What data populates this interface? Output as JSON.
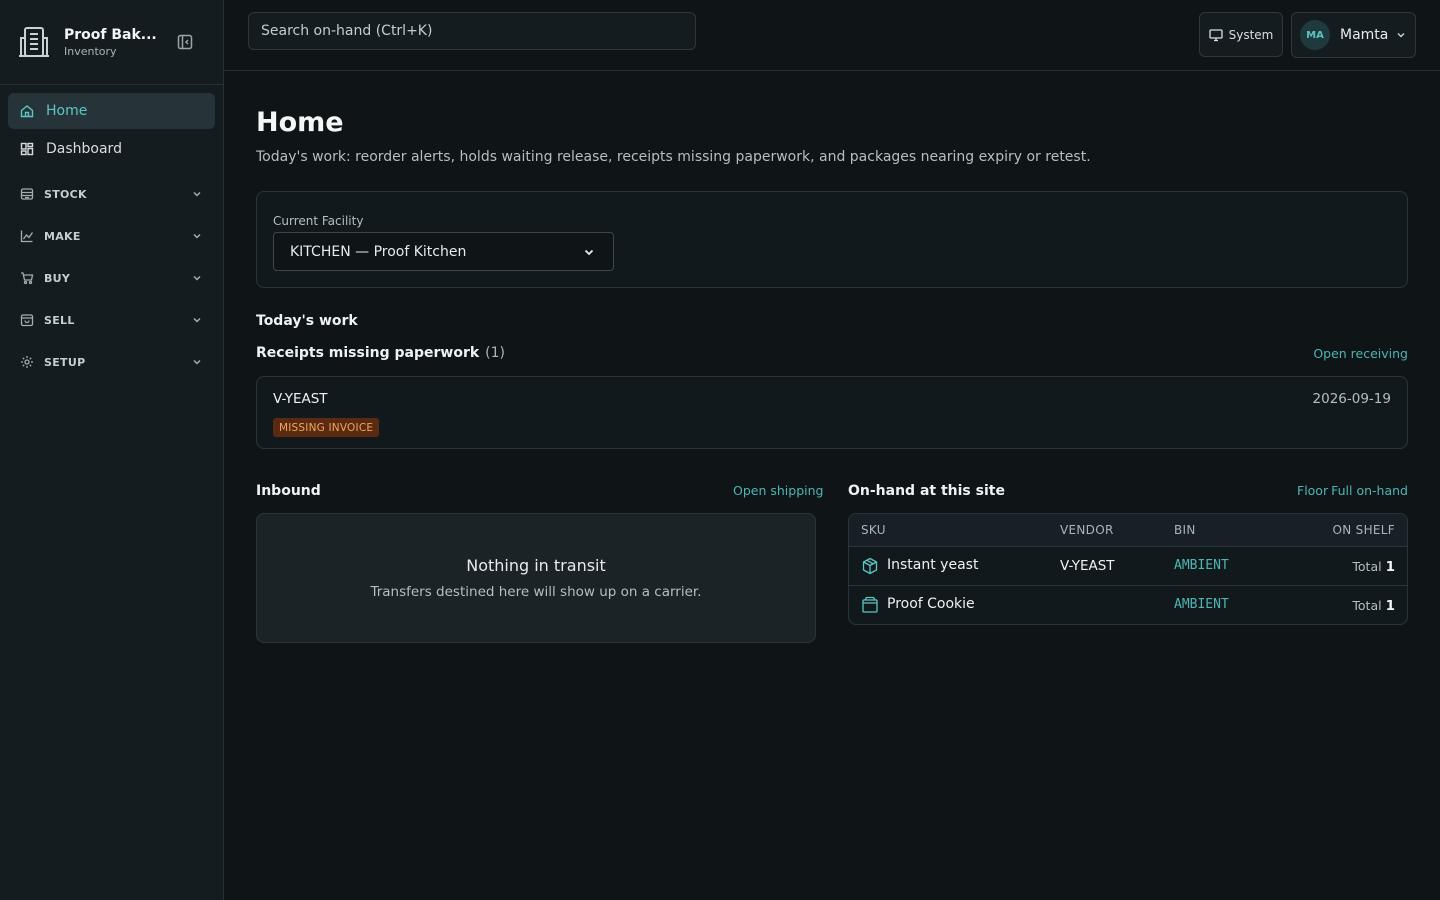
{
  "brand": {
    "name": "Proof Bak...",
    "subtitle": "Inventory"
  },
  "sidebar": {
    "items": [
      {
        "label": "Home",
        "icon": "home-icon",
        "active": true
      },
      {
        "label": "Dashboard",
        "icon": "dashboard-icon",
        "active": false
      }
    ],
    "groups": [
      {
        "label": "STOCK",
        "icon": "stock-icon"
      },
      {
        "label": "MAKE",
        "icon": "make-icon"
      },
      {
        "label": "BUY",
        "icon": "cart-icon"
      },
      {
        "label": "SELL",
        "icon": "bag-icon"
      },
      {
        "label": "SETUP",
        "icon": "gear-icon"
      }
    ]
  },
  "topbar": {
    "search_placeholder": "Search on-hand (Ctrl+K)",
    "theme_label": "System",
    "user_initials": "MA",
    "user_name": "Mamta"
  },
  "page": {
    "title": "Home",
    "description": "Today's work: reorder alerts, holds waiting release, receipts missing paperwork, and packages nearing expiry or retest."
  },
  "facility": {
    "label": "Current Facility",
    "selected": "KITCHEN — Proof Kitchen"
  },
  "todays_work": {
    "heading": "Today's work",
    "receipts": {
      "heading": "Receipts missing paperwork",
      "count": "(1)",
      "link": "Open receiving",
      "items": [
        {
          "vendor": "V-YEAST",
          "date": "2026-09-19",
          "badge": "MISSING INVOICE"
        }
      ]
    }
  },
  "inbound": {
    "heading": "Inbound",
    "link": "Open shipping",
    "empty_title": "Nothing in transit",
    "empty_sub": "Transfers destined here will show up on a carrier."
  },
  "onhand": {
    "heading": "On-hand at this site",
    "links": [
      "Floor",
      "Full on-hand"
    ],
    "columns": [
      "SKU",
      "VENDOR",
      "BIN",
      "ON SHELF"
    ],
    "rows": [
      {
        "sku": "Instant yeast",
        "vendor": "V-YEAST",
        "bin": "AMBIENT",
        "total_label": "Total",
        "total": "1",
        "icon": "package-icon"
      },
      {
        "sku": "Proof Cookie",
        "vendor": "",
        "bin": "AMBIENT",
        "total_label": "Total",
        "total": "1",
        "icon": "box-icon"
      }
    ]
  },
  "colors": {
    "accent": "#5cc6c4",
    "badge_bg": "#5a2a12",
    "badge_text": "#f0a85a",
    "background": "#0f1417"
  }
}
